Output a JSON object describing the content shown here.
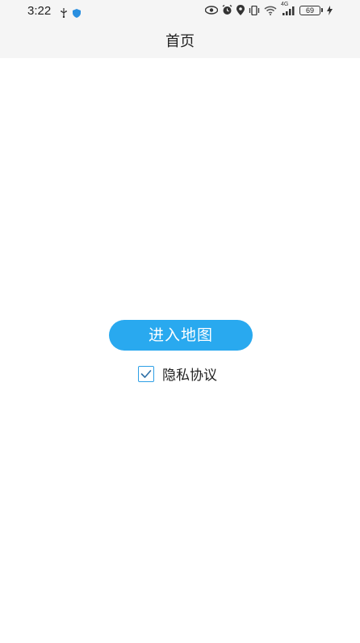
{
  "status_bar": {
    "time": "3:22",
    "network": "4G",
    "battery_level": "69",
    "icons": [
      "usb-icon",
      "shield-icon",
      "eye-icon",
      "alarm-icon",
      "location-icon",
      "vibrate-icon",
      "wifi-icon",
      "signal-icon",
      "battery-icon",
      "charging-icon"
    ]
  },
  "header": {
    "title": "首页"
  },
  "main": {
    "enter_map_label": "进入地图",
    "privacy_label": "隐私协议",
    "privacy_checked": true
  },
  "colors": {
    "accent": "#29a9ef",
    "header_bg": "#f5f5f5",
    "checkbox_border": "#2d9fe6"
  }
}
